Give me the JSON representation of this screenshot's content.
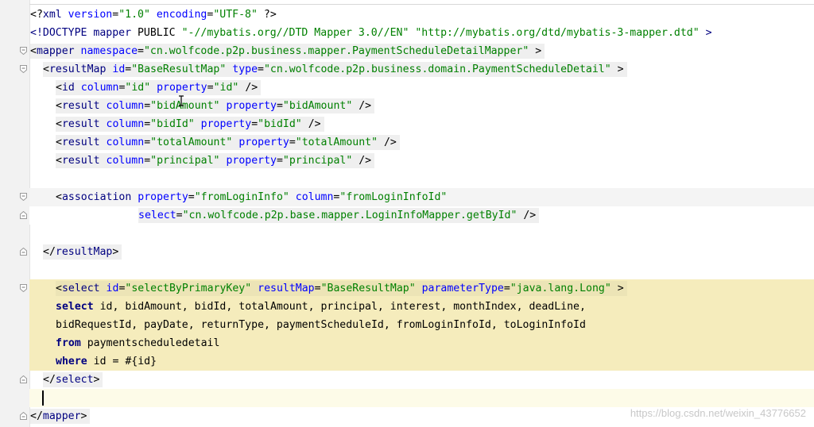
{
  "editor": {
    "lines": [
      {
        "id": "xml-decl",
        "fold": "none",
        "tokens": [
          {
            "c": "t-bracket",
            "t": "<?"
          },
          {
            "c": "t-tag",
            "t": "xml"
          },
          {
            "c": "t-pi",
            "t": " "
          },
          {
            "c": "t-attr",
            "t": "version"
          },
          {
            "c": "t-pi",
            "t": "="
          },
          {
            "c": "t-val",
            "t": "\"1.0\""
          },
          {
            "c": "t-pi",
            "t": " "
          },
          {
            "c": "t-attr",
            "t": "encoding"
          },
          {
            "c": "t-pi",
            "t": "="
          },
          {
            "c": "t-val",
            "t": "\"UTF-8\""
          },
          {
            "c": "t-pi",
            "t": " "
          },
          {
            "c": "t-bracket",
            "t": "?>"
          }
        ]
      },
      {
        "id": "doctype",
        "fold": "none",
        "tokens": [
          {
            "c": "t-doctype",
            "t": "<!DOCTYPE "
          },
          {
            "c": "t-doctype",
            "t": "mapper"
          },
          {
            "c": "t-dtext",
            "t": " PUBLIC "
          },
          {
            "c": "t-val",
            "t": "\"-//mybatis.org//DTD Mapper 3.0//EN\""
          },
          {
            "c": "t-dtext",
            "t": " "
          },
          {
            "c": "t-val",
            "t": "\"http://mybatis.org/dtd/mybatis-3-mapper.dtd\""
          },
          {
            "c": "t-doctype",
            "t": " >"
          }
        ]
      },
      {
        "id": "mapper-open",
        "fold": "open",
        "tokens": [
          {
            "c": "t-bracket",
            "t": "<"
          },
          {
            "c": "t-tag",
            "t": "mapper"
          },
          {
            "c": "t-pi",
            "t": " "
          },
          {
            "c": "t-attr",
            "t": "namespace"
          },
          {
            "c": "t-pi",
            "t": "="
          },
          {
            "c": "t-val",
            "t": "\"cn.wolfcode.p2p.business.mapper.PaymentScheduleDetailMapper\""
          },
          {
            "c": "t-pi",
            "t": " "
          },
          {
            "c": "t-bracket",
            "t": ">"
          }
        ]
      },
      {
        "id": "resultmap-open",
        "fold": "open",
        "tokens": [
          {
            "c": "t-bracket",
            "t": "<"
          },
          {
            "c": "t-tag",
            "t": "resultMap"
          },
          {
            "c": "t-pi",
            "t": " "
          },
          {
            "c": "t-attr",
            "t": "id"
          },
          {
            "c": "t-pi",
            "t": "="
          },
          {
            "c": "t-val",
            "t": "\"BaseResultMap\""
          },
          {
            "c": "t-pi",
            "t": " "
          },
          {
            "c": "t-attr",
            "t": "type"
          },
          {
            "c": "t-pi",
            "t": "="
          },
          {
            "c": "t-val",
            "t": "\"cn.wolfcode.p2p.business.domain.PaymentScheduleDetail\""
          },
          {
            "c": "t-pi",
            "t": " "
          },
          {
            "c": "t-bracket",
            "t": ">"
          }
        ]
      },
      {
        "id": "id-line",
        "fold": "none",
        "tokens": [
          {
            "c": "t-bracket",
            "t": "<"
          },
          {
            "c": "t-tag",
            "t": "id"
          },
          {
            "c": "t-pi",
            "t": " "
          },
          {
            "c": "t-attr",
            "t": "column"
          },
          {
            "c": "t-pi",
            "t": "="
          },
          {
            "c": "t-val",
            "t": "\"id\""
          },
          {
            "c": "t-pi",
            "t": " "
          },
          {
            "c": "t-attr",
            "t": "property"
          },
          {
            "c": "t-pi",
            "t": "="
          },
          {
            "c": "t-val",
            "t": "\"id\""
          },
          {
            "c": "t-pi",
            "t": " "
          },
          {
            "c": "t-bracket",
            "t": "/>"
          }
        ]
      },
      {
        "id": "result-bidamount",
        "fold": "none",
        "tokens": [
          {
            "c": "t-bracket",
            "t": "<"
          },
          {
            "c": "t-tag",
            "t": "result"
          },
          {
            "c": "t-pi",
            "t": " "
          },
          {
            "c": "t-attr",
            "t": "column"
          },
          {
            "c": "t-pi",
            "t": "="
          },
          {
            "c": "t-val",
            "t": "\"bidAmount\""
          },
          {
            "c": "t-pi",
            "t": " "
          },
          {
            "c": "t-attr",
            "t": "property"
          },
          {
            "c": "t-pi",
            "t": "="
          },
          {
            "c": "t-val",
            "t": "\"bidAmount\""
          },
          {
            "c": "t-pi",
            "t": " "
          },
          {
            "c": "t-bracket",
            "t": "/>"
          }
        ]
      },
      {
        "id": "result-bidid",
        "fold": "none",
        "tokens": [
          {
            "c": "t-bracket",
            "t": "<"
          },
          {
            "c": "t-tag",
            "t": "result"
          },
          {
            "c": "t-pi",
            "t": " "
          },
          {
            "c": "t-attr",
            "t": "column"
          },
          {
            "c": "t-pi",
            "t": "="
          },
          {
            "c": "t-val",
            "t": "\"bidId\""
          },
          {
            "c": "t-pi",
            "t": " "
          },
          {
            "c": "t-attr",
            "t": "property"
          },
          {
            "c": "t-pi",
            "t": "="
          },
          {
            "c": "t-val",
            "t": "\"bidId\""
          },
          {
            "c": "t-pi",
            "t": " "
          },
          {
            "c": "t-bracket",
            "t": "/>"
          }
        ]
      },
      {
        "id": "result-totalamount",
        "fold": "none",
        "tokens": [
          {
            "c": "t-bracket",
            "t": "<"
          },
          {
            "c": "t-tag",
            "t": "result"
          },
          {
            "c": "t-pi",
            "t": " "
          },
          {
            "c": "t-attr",
            "t": "column"
          },
          {
            "c": "t-pi",
            "t": "="
          },
          {
            "c": "t-val",
            "t": "\"totalAmount\""
          },
          {
            "c": "t-pi",
            "t": " "
          },
          {
            "c": "t-attr",
            "t": "property"
          },
          {
            "c": "t-pi",
            "t": "="
          },
          {
            "c": "t-val",
            "t": "\"totalAmount\""
          },
          {
            "c": "t-pi",
            "t": " "
          },
          {
            "c": "t-bracket",
            "t": "/>"
          }
        ]
      },
      {
        "id": "result-principal",
        "fold": "none",
        "tokens": [
          {
            "c": "t-bracket",
            "t": "<"
          },
          {
            "c": "t-tag",
            "t": "result"
          },
          {
            "c": "t-pi",
            "t": " "
          },
          {
            "c": "t-attr",
            "t": "column"
          },
          {
            "c": "t-pi",
            "t": "="
          },
          {
            "c": "t-val",
            "t": "\"principal\""
          },
          {
            "c": "t-pi",
            "t": " "
          },
          {
            "c": "t-attr",
            "t": "property"
          },
          {
            "c": "t-pi",
            "t": "="
          },
          {
            "c": "t-val",
            "t": "\"principal\""
          },
          {
            "c": "t-pi",
            "t": " "
          },
          {
            "c": "t-bracket",
            "t": "/>"
          }
        ]
      },
      {
        "id": "blank-1",
        "fold": "none",
        "tokens": []
      },
      {
        "id": "association-open",
        "fold": "open",
        "tokens": [
          {
            "c": "t-bracket",
            "t": "<"
          },
          {
            "c": "t-tag",
            "t": "association"
          },
          {
            "c": "t-pi",
            "t": " "
          },
          {
            "c": "t-attr",
            "t": "property"
          },
          {
            "c": "t-pi",
            "t": "="
          },
          {
            "c": "t-val",
            "t": "\"fromLoginInfo\""
          },
          {
            "c": "t-pi",
            "t": " "
          },
          {
            "c": "t-attr",
            "t": "column"
          },
          {
            "c": "t-pi",
            "t": "="
          },
          {
            "c": "t-val",
            "t": "\"fromLoginInfoId\""
          }
        ]
      },
      {
        "id": "association-select",
        "fold": "close",
        "tokens": [
          {
            "c": "t-attr",
            "t": "select"
          },
          {
            "c": "t-pi",
            "t": "="
          },
          {
            "c": "t-val",
            "t": "\"cn.wolfcode.p2p.base.mapper.LoginInfoMapper.getById\""
          },
          {
            "c": "t-pi",
            "t": " "
          },
          {
            "c": "t-bracket",
            "t": "/>"
          }
        ]
      },
      {
        "id": "blank-2",
        "fold": "none",
        "tokens": []
      },
      {
        "id": "resultmap-close",
        "fold": "close",
        "tokens": [
          {
            "c": "t-bracket",
            "t": "</"
          },
          {
            "c": "t-tag",
            "t": "resultMap"
          },
          {
            "c": "t-bracket",
            "t": ">"
          }
        ]
      },
      {
        "id": "blank-3",
        "fold": "none",
        "tokens": []
      },
      {
        "id": "select-open",
        "fold": "open",
        "tokens": [
          {
            "c": "t-bracket",
            "t": "<"
          },
          {
            "c": "t-tag",
            "t": "select"
          },
          {
            "c": "t-pi",
            "t": " "
          },
          {
            "c": "t-attr",
            "t": "id"
          },
          {
            "c": "t-pi",
            "t": "="
          },
          {
            "c": "t-val",
            "t": "\"selectByPrimaryKey\""
          },
          {
            "c": "t-pi",
            "t": " "
          },
          {
            "c": "t-attr",
            "t": "resultMap"
          },
          {
            "c": "t-pi",
            "t": "="
          },
          {
            "c": "t-val",
            "t": "\"BaseResultMap\""
          },
          {
            "c": "t-pi",
            "t": " "
          },
          {
            "c": "t-attr",
            "t": "parameterType"
          },
          {
            "c": "t-pi",
            "t": "="
          },
          {
            "c": "t-val",
            "t": "\"java.lang.Long\""
          },
          {
            "c": "t-pi",
            "t": " "
          },
          {
            "c": "t-bracket",
            "t": ">"
          }
        ]
      },
      {
        "id": "sql-select",
        "fold": "none",
        "tokens": [
          {
            "c": "t-kw",
            "t": "select"
          },
          {
            "c": "t-sql",
            "t": " id, bidAmount, bidId, totalAmount, principal, interest, monthIndex, deadLine,"
          }
        ]
      },
      {
        "id": "sql-cols",
        "fold": "none",
        "tokens": [
          {
            "c": "t-sql",
            "t": "bidRequestId, payDate, returnType, paymentScheduleId, fromLoginInfoId, toLoginInfoId"
          }
        ]
      },
      {
        "id": "sql-from",
        "fold": "none",
        "tokens": [
          {
            "c": "t-kw",
            "t": "from"
          },
          {
            "c": "t-sql",
            "t": " paymentscheduledetail"
          }
        ]
      },
      {
        "id": "sql-where",
        "fold": "none",
        "tokens": [
          {
            "c": "t-kw",
            "t": "where"
          },
          {
            "c": "t-sql",
            "t": " id = #{id}"
          }
        ]
      },
      {
        "id": "select-close",
        "fold": "close",
        "tokens": [
          {
            "c": "t-bracket",
            "t": "</"
          },
          {
            "c": "t-tag",
            "t": "select"
          },
          {
            "c": "t-bracket",
            "t": ">"
          }
        ]
      },
      {
        "id": "caret-line",
        "fold": "none",
        "tokens": []
      },
      {
        "id": "mapper-close",
        "fold": "close",
        "tokens": [
          {
            "c": "t-bracket",
            "t": "</"
          },
          {
            "c": "t-tag",
            "t": "mapper"
          },
          {
            "c": "t-bracket",
            "t": ">"
          }
        ]
      }
    ]
  },
  "watermark": "https://blog.csdn.net/weixin_43776652",
  "colors": {
    "tag": "#000080",
    "attribute": "#0000ff",
    "value": "#008000",
    "select_highlight": "#f5ecbc",
    "tag_highlight": "#efefef",
    "gutter": "#f2f2f2"
  }
}
